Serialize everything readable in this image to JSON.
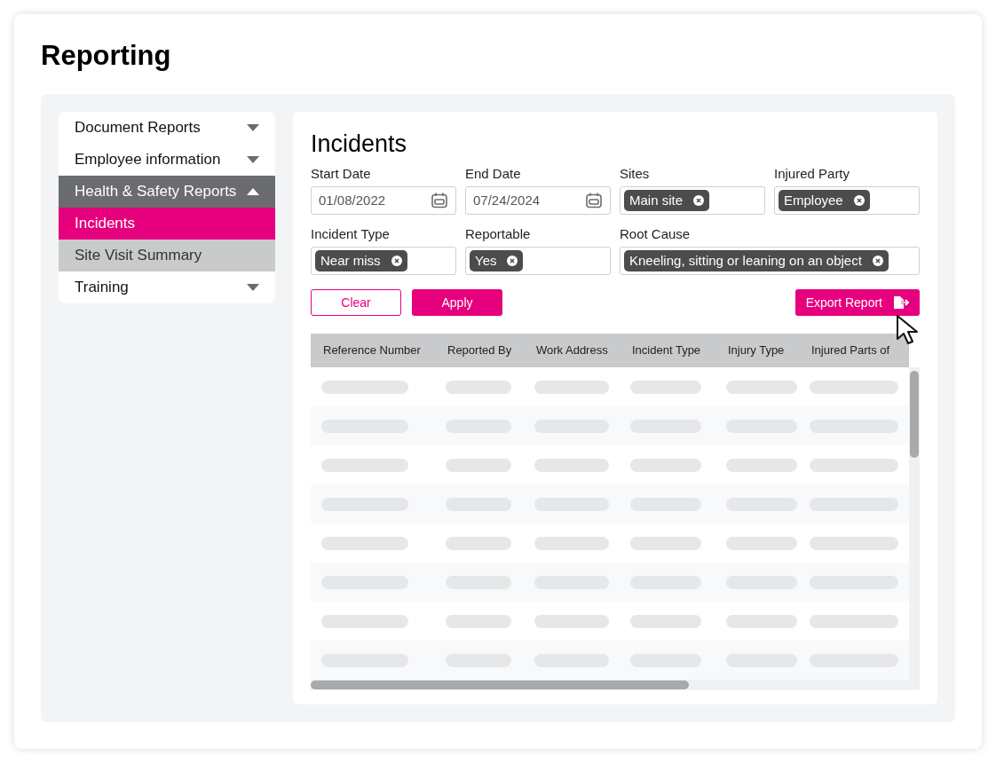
{
  "page": {
    "title": "Reporting"
  },
  "sidebar": {
    "items": [
      {
        "label": "Document Reports",
        "expanded": false
      },
      {
        "label": "Employee information",
        "expanded": false
      },
      {
        "label": "Health & Safety Reports",
        "expanded": true,
        "children": [
          {
            "label": "Incidents",
            "selected": true
          },
          {
            "label": "Site Visit Summary",
            "selected": false
          }
        ]
      },
      {
        "label": "Training",
        "expanded": false
      }
    ]
  },
  "main": {
    "title": "Incidents",
    "filters": [
      {
        "kind": "date",
        "label": "Start Date",
        "value": "01/08/2022"
      },
      {
        "kind": "date",
        "label": "End Date",
        "value": "07/24/2024"
      },
      {
        "kind": "chips",
        "label": "Sites",
        "chips": [
          "Main site"
        ]
      },
      {
        "kind": "chips",
        "label": "Injured Party",
        "chips": [
          "Employee"
        ]
      },
      {
        "kind": "chips",
        "label": "Incident Type",
        "chips": [
          "Near miss"
        ]
      },
      {
        "kind": "chips",
        "label": "Reportable",
        "chips": [
          "Yes"
        ]
      },
      {
        "kind": "chips",
        "label": "Root Cause",
        "wide": true,
        "chips": [
          "Kneeling, sitting or leaning on an object"
        ]
      }
    ],
    "buttons": {
      "clear": "Clear",
      "apply": "Apply",
      "export": "Export Report"
    },
    "table": {
      "columns": [
        "Reference Number",
        "Reported By",
        "Work Address",
        "Incident Type",
        "Injury Type",
        "Injured Parts of"
      ]
    }
  }
}
